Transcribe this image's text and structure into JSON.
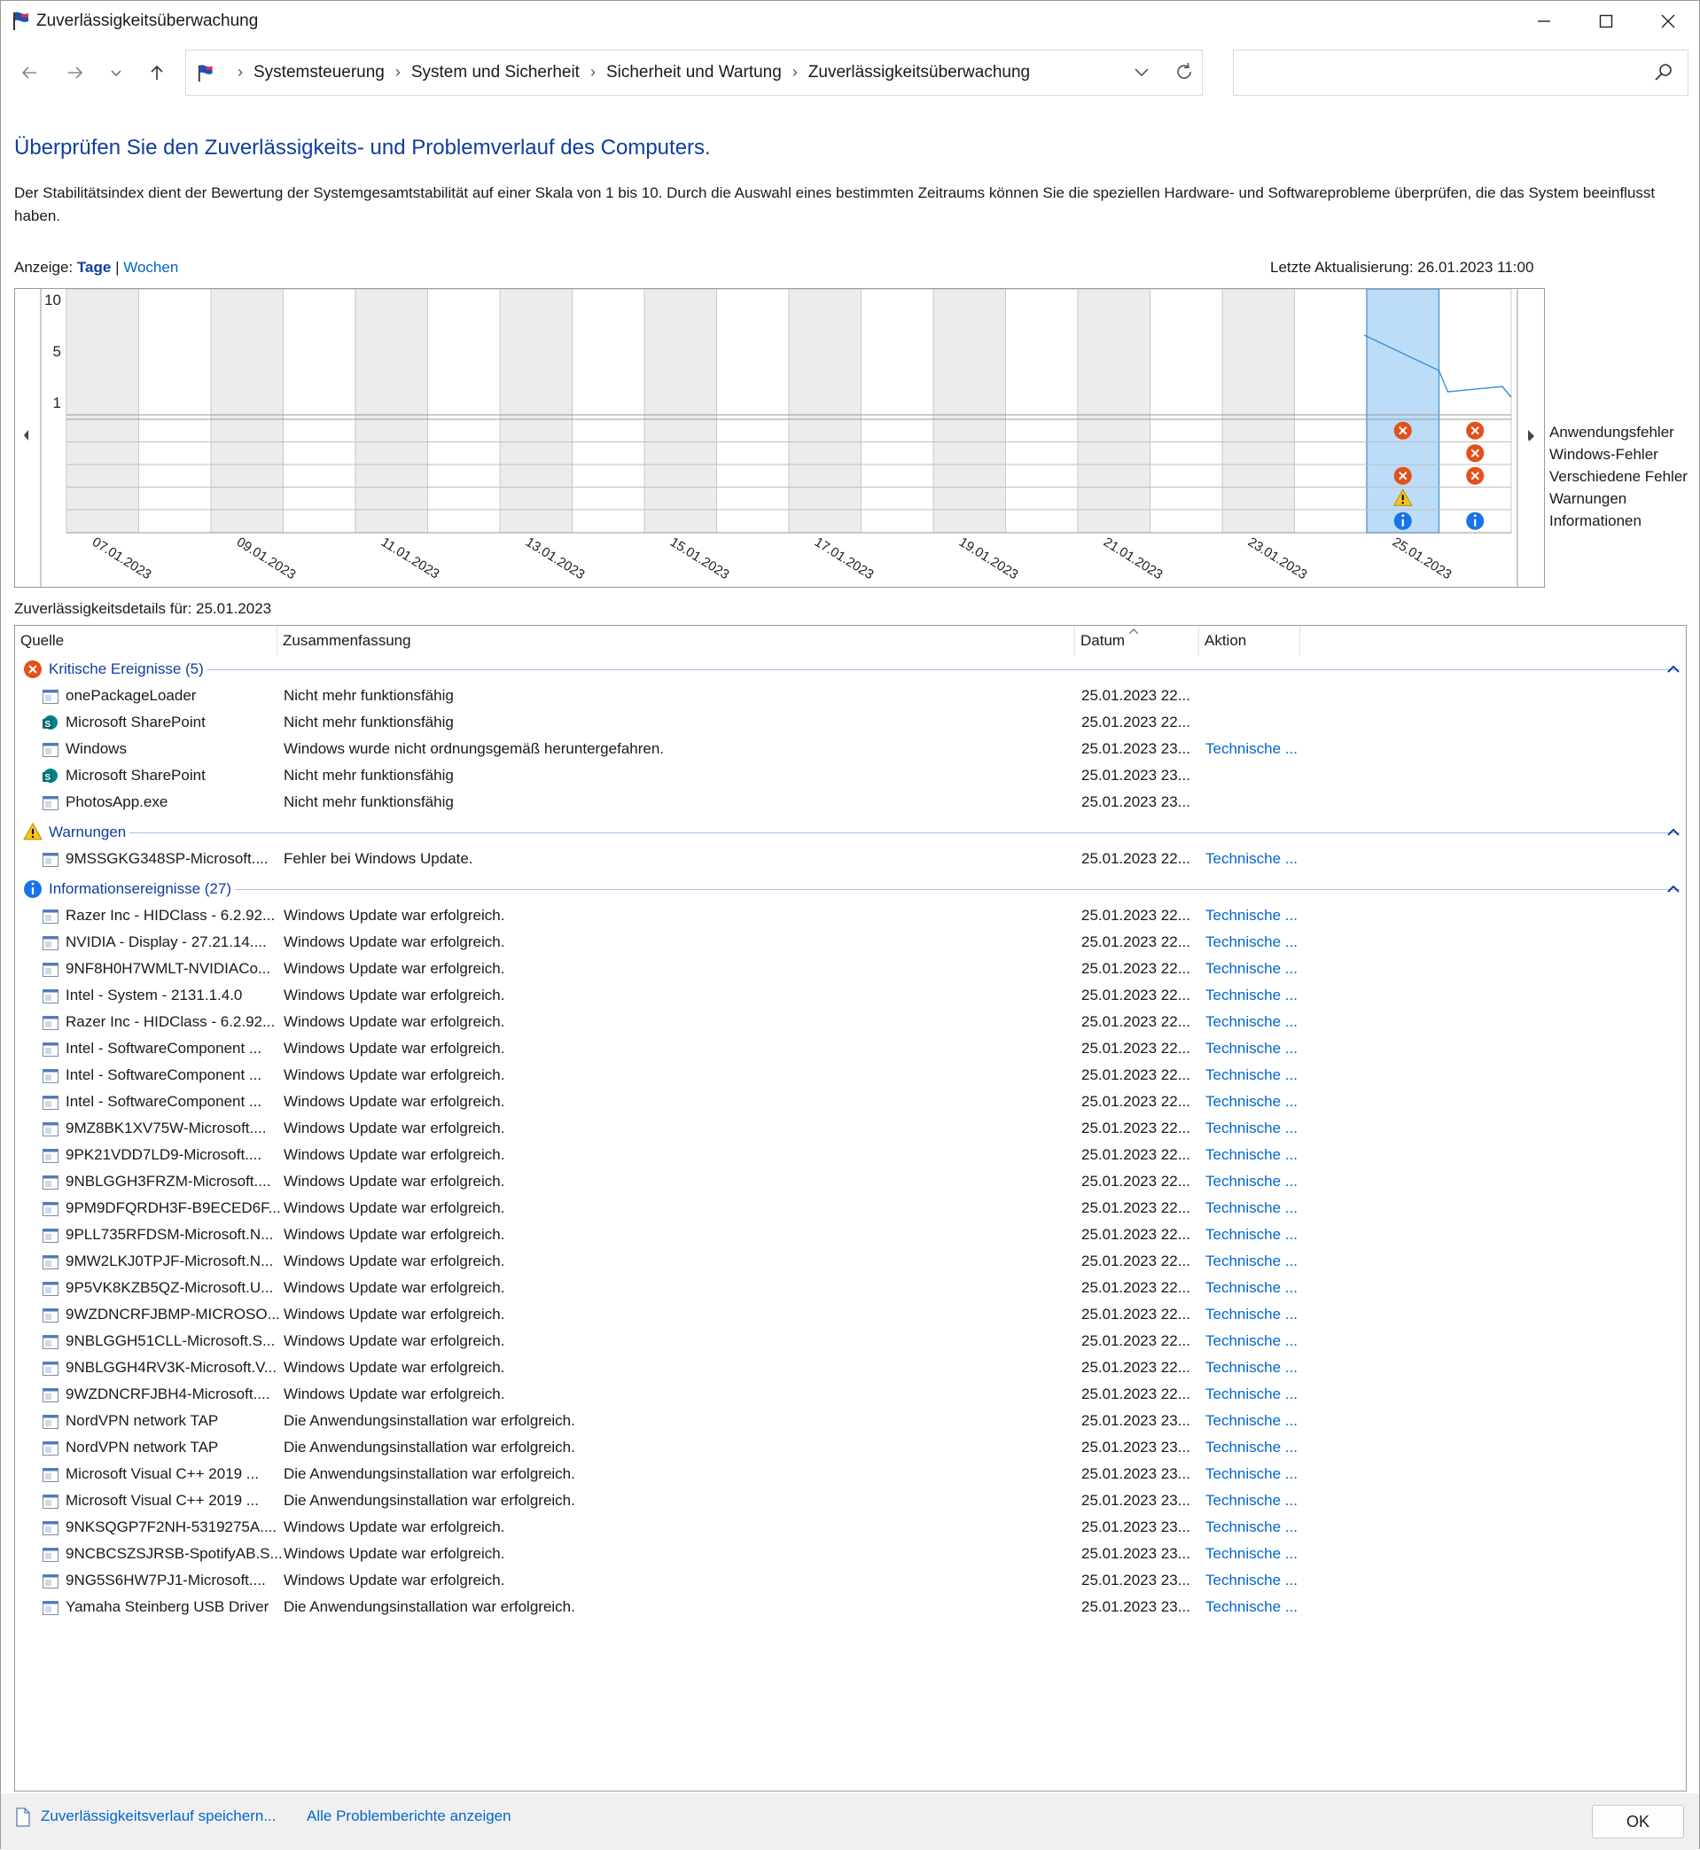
{
  "window": {
    "title": "Zuverlässigkeitsüberwachung"
  },
  "address": {
    "crumbs": [
      "Systemsteuerung",
      "System und Sicherheit",
      "Sicherheit und Wartung",
      "Zuverlässigkeitsüberwachung"
    ],
    "search_placeholder": ""
  },
  "heading": "Überprüfen Sie den Zuverlässigkeits- und Problemverlauf des Computers.",
  "description": "Der Stabilitätsindex dient der Bewertung der Systemgesamtstabilität auf einer Skala von 1 bis 10. Durch die Auswahl eines bestimmten Zeitraums können Sie die speziellen Hardware- und Softwareprobleme überprüfen, die das System beeinflusst haben.",
  "view": {
    "label": "Anzeige:",
    "days": "Tage",
    "sep": "|",
    "weeks": "Wochen"
  },
  "last_update": "Letzte Aktualisierung: 26.01.2023 11:00",
  "chart": {
    "y_ticks": [
      "10",
      "5",
      "1"
    ],
    "x_labels": [
      "07.01.2023",
      "09.01.2023",
      "11.01.2023",
      "13.01.2023",
      "15.01.2023",
      "17.01.2023",
      "19.01.2023",
      "21.01.2023",
      "23.01.2023",
      "25.01.2023"
    ],
    "legend": [
      "Anwendungsfehler",
      "Windows-Fehler",
      "Verschiedene Fehler",
      "Warnungen",
      "Informationen"
    ],
    "selected_day": "25.01.2023",
    "colors": {
      "line": "#3c8fd8",
      "selected": "#bcdcf7",
      "error": "#e3501b",
      "warn": "#f5c518",
      "info": "#1a73e8"
    }
  },
  "details_label": "Zuverlässigkeitsdetails für: 25.01.2023",
  "columns": {
    "source": "Quelle",
    "summary": "Zusammenfassung",
    "date": "Datum",
    "action": "Aktion"
  },
  "groups": {
    "critical": {
      "title": "Kritische Ereignisse (5)"
    },
    "warnings": {
      "title": "Warnungen"
    },
    "info": {
      "title": "Informationsereignisse (27)"
    }
  },
  "critical_rows": [
    {
      "src": "onePackageLoader",
      "sum": "Nicht mehr funktionsfähig",
      "dt": "25.01.2023 22...",
      "act": "",
      "icon": "app"
    },
    {
      "src": "Microsoft SharePoint",
      "sum": "Nicht mehr funktionsfähig",
      "dt": "25.01.2023 22...",
      "act": "",
      "icon": "sharepoint"
    },
    {
      "src": "Windows",
      "sum": "Windows wurde nicht ordnungsgemäß heruntergefahren.",
      "dt": "25.01.2023 23...",
      "act": "Technische ...",
      "icon": "app"
    },
    {
      "src": "Microsoft SharePoint",
      "sum": "Nicht mehr funktionsfähig",
      "dt": "25.01.2023 23...",
      "act": "",
      "icon": "sharepoint"
    },
    {
      "src": "PhotosApp.exe",
      "sum": "Nicht mehr funktionsfähig",
      "dt": "25.01.2023 23...",
      "act": "",
      "icon": "app"
    }
  ],
  "warning_rows": [
    {
      "src": "9MSSGKG348SP-Microsoft....",
      "sum": "Fehler bei Windows Update.",
      "dt": "25.01.2023 22...",
      "act": "Technische ...",
      "icon": "app"
    }
  ],
  "info_rows": [
    {
      "src": "Razer Inc - HIDClass - 6.2.92...",
      "sum": "Windows Update war erfolgreich.",
      "dt": "25.01.2023 22...",
      "act": "Technische ...",
      "icon": "app"
    },
    {
      "src": "NVIDIA - Display - 27.21.14....",
      "sum": "Windows Update war erfolgreich.",
      "dt": "25.01.2023 22...",
      "act": "Technische ...",
      "icon": "app"
    },
    {
      "src": "9NF8H0H7WMLT-NVIDIACo...",
      "sum": "Windows Update war erfolgreich.",
      "dt": "25.01.2023 22...",
      "act": "Technische ...",
      "icon": "app"
    },
    {
      "src": "Intel - System - 2131.1.4.0",
      "sum": "Windows Update war erfolgreich.",
      "dt": "25.01.2023 22...",
      "act": "Technische ...",
      "icon": "app"
    },
    {
      "src": "Razer Inc - HIDClass - 6.2.92...",
      "sum": "Windows Update war erfolgreich.",
      "dt": "25.01.2023 22...",
      "act": "Technische ...",
      "icon": "app"
    },
    {
      "src": "Intel - SoftwareComponent ...",
      "sum": "Windows Update war erfolgreich.",
      "dt": "25.01.2023 22...",
      "act": "Technische ...",
      "icon": "app"
    },
    {
      "src": "Intel - SoftwareComponent ...",
      "sum": "Windows Update war erfolgreich.",
      "dt": "25.01.2023 22...",
      "act": "Technische ...",
      "icon": "app"
    },
    {
      "src": "Intel - SoftwareComponent ...",
      "sum": "Windows Update war erfolgreich.",
      "dt": "25.01.2023 22...",
      "act": "Technische ...",
      "icon": "app"
    },
    {
      "src": "9MZ8BK1XV75W-Microsoft....",
      "sum": "Windows Update war erfolgreich.",
      "dt": "25.01.2023 22...",
      "act": "Technische ...",
      "icon": "app"
    },
    {
      "src": "9PK21VDD7LD9-Microsoft....",
      "sum": "Windows Update war erfolgreich.",
      "dt": "25.01.2023 22...",
      "act": "Technische ...",
      "icon": "app"
    },
    {
      "src": "9NBLGGH3FRZM-Microsoft....",
      "sum": "Windows Update war erfolgreich.",
      "dt": "25.01.2023 22...",
      "act": "Technische ...",
      "icon": "app"
    },
    {
      "src": "9PM9DFQRDH3F-B9ECED6F...",
      "sum": "Windows Update war erfolgreich.",
      "dt": "25.01.2023 22...",
      "act": "Technische ...",
      "icon": "app"
    },
    {
      "src": "9PLL735RFDSM-Microsoft.N...",
      "sum": "Windows Update war erfolgreich.",
      "dt": "25.01.2023 22...",
      "act": "Technische ...",
      "icon": "app"
    },
    {
      "src": "9MW2LKJ0TPJF-Microsoft.N...",
      "sum": "Windows Update war erfolgreich.",
      "dt": "25.01.2023 22...",
      "act": "Technische ...",
      "icon": "app"
    },
    {
      "src": "9P5VK8KZB5QZ-Microsoft.U...",
      "sum": "Windows Update war erfolgreich.",
      "dt": "25.01.2023 22...",
      "act": "Technische ...",
      "icon": "app"
    },
    {
      "src": "9WZDNCRFJBMP-MICROSO...",
      "sum": "Windows Update war erfolgreich.",
      "dt": "25.01.2023 22...",
      "act": "Technische ...",
      "icon": "app"
    },
    {
      "src": "9NBLGGH51CLL-Microsoft.S...",
      "sum": "Windows Update war erfolgreich.",
      "dt": "25.01.2023 22...",
      "act": "Technische ...",
      "icon": "app"
    },
    {
      "src": "9NBLGGH4RV3K-Microsoft.V...",
      "sum": "Windows Update war erfolgreich.",
      "dt": "25.01.2023 22...",
      "act": "Technische ...",
      "icon": "app"
    },
    {
      "src": "9WZDNCRFJBH4-Microsoft....",
      "sum": "Windows Update war erfolgreich.",
      "dt": "25.01.2023 22...",
      "act": "Technische ...",
      "icon": "app"
    },
    {
      "src": "NordVPN network TAP",
      "sum": "Die Anwendungsinstallation war erfolgreich.",
      "dt": "25.01.2023 23...",
      "act": "Technische ...",
      "icon": "app"
    },
    {
      "src": "NordVPN network TAP",
      "sum": "Die Anwendungsinstallation war erfolgreich.",
      "dt": "25.01.2023 23...",
      "act": "Technische ...",
      "icon": "app"
    },
    {
      "src": "Microsoft Visual C++ 2019 ...",
      "sum": "Die Anwendungsinstallation war erfolgreich.",
      "dt": "25.01.2023 23...",
      "act": "Technische ...",
      "icon": "app"
    },
    {
      "src": "Microsoft Visual C++ 2019 ...",
      "sum": "Die Anwendungsinstallation war erfolgreich.",
      "dt": "25.01.2023 23...",
      "act": "Technische ...",
      "icon": "app"
    },
    {
      "src": "9NKSQGP7F2NH-5319275A....",
      "sum": "Windows Update war erfolgreich.",
      "dt": "25.01.2023 23...",
      "act": "Technische ...",
      "icon": "app"
    },
    {
      "src": "9NCBCSZSJRSB-SpotifyAB.S...",
      "sum": "Windows Update war erfolgreich.",
      "dt": "25.01.2023 23...",
      "act": "Technische ...",
      "icon": "app"
    },
    {
      "src": "9NG5S6HW7PJ1-Microsoft....",
      "sum": "Windows Update war erfolgreich.",
      "dt": "25.01.2023 23...",
      "act": "Technische ...",
      "icon": "app"
    },
    {
      "src": "Yamaha Steinberg USB Driver",
      "sum": "Die Anwendungsinstallation war erfolgreich.",
      "dt": "25.01.2023 23...",
      "act": "Technische ...",
      "icon": "app"
    }
  ],
  "footer": {
    "save": "Zuverlässigkeitsverlauf speichern...",
    "all": "Alle Problemberichte anzeigen",
    "ok": "OK"
  }
}
